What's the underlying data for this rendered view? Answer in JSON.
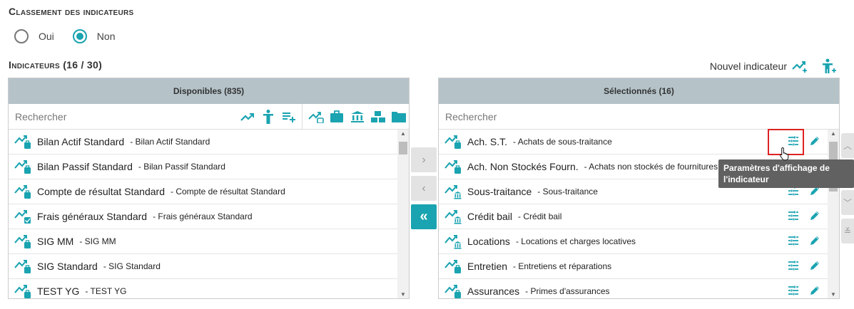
{
  "ranking": {
    "title": "Classement des indicateurs",
    "options": [
      "Oui",
      "Non"
    ],
    "selected": "Non"
  },
  "indicators": {
    "title": "Indicateurs (16 / 30)",
    "new_label": "Nouvel indicateur"
  },
  "available": {
    "header": "Disponibles (835)",
    "search_placeholder": "Rechercher",
    "items": [
      {
        "name": "Bilan Actif Standard",
        "desc": "- Bilan Actif Standard",
        "icon": "chart-bag-icon"
      },
      {
        "name": "Bilan Passif Standard",
        "desc": "- Bilan Passif Standard",
        "icon": "chart-bag-icon"
      },
      {
        "name": "Compte de résultat Standard",
        "desc": "- Compte de résultat Standard",
        "icon": "chart-bag-icon"
      },
      {
        "name": "Frais généraux Standard",
        "desc": "- Frais généraux Standard",
        "icon": "chart-check-icon"
      },
      {
        "name": "SIG MM",
        "desc": "- SIG MM",
        "icon": "chart-bag-icon"
      },
      {
        "name": "SIG Standard",
        "desc": "- SIG Standard",
        "icon": "chart-bag-icon"
      },
      {
        "name": "TEST YG",
        "desc": "- TEST YG",
        "icon": "chart-bag-icon"
      }
    ]
  },
  "selected": {
    "header": "Sélectionnés (16)",
    "search_placeholder": "Rechercher",
    "items": [
      {
        "name": "Ach. S.T.",
        "desc": "- Achats de sous-traitance",
        "icon": "chart-bag-icon"
      },
      {
        "name": "Ach. Non Stockés Fourn.",
        "desc": "- Achats non stockés de fournitures",
        "icon": "chart-bag-icon"
      },
      {
        "name": "Sous-traitance",
        "desc": "- Sous-traitance",
        "icon": "chart-bank-icon"
      },
      {
        "name": "Crédit bail",
        "desc": "- Crédit bail",
        "icon": "chart-bank-icon"
      },
      {
        "name": "Locations",
        "desc": "- Locations et charges locatives",
        "icon": "chart-bank-icon"
      },
      {
        "name": "Entretien",
        "desc": "- Entretiens et réparations",
        "icon": "chart-bag-icon"
      },
      {
        "name": "Assurances",
        "desc": "- Primes d'assurances",
        "icon": "chart-bag-icon"
      }
    ]
  },
  "tooltip": {
    "text": "Paramètres d'affichage de l'indicateur"
  },
  "colors": {
    "accent": "#1aa3b0",
    "header_bg": "#b5c3c9",
    "highlight": "#dd2222"
  }
}
